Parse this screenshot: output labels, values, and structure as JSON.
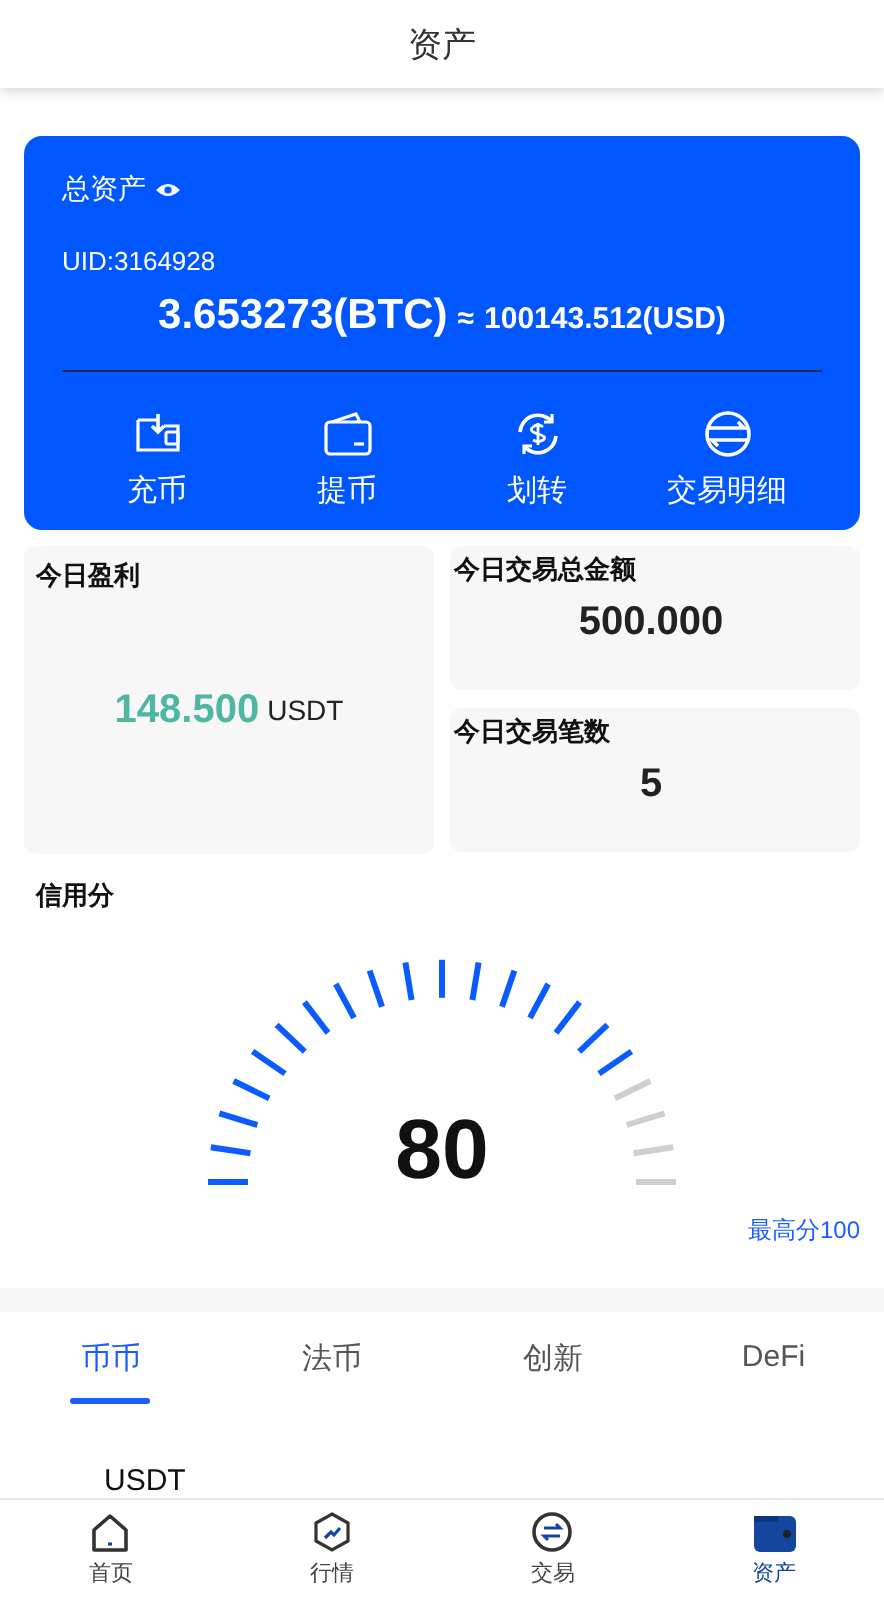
{
  "header": {
    "title": "资产"
  },
  "asset_card": {
    "label": "总资产",
    "uid": "UID:3164928",
    "btc": "3.653273(BTC)",
    "approx": "≈",
    "usd": "100143.512(USD)",
    "actions": [
      {
        "kind": "deposit",
        "label": "充币"
      },
      {
        "kind": "withdraw",
        "label": "提币"
      },
      {
        "kind": "transfer",
        "label": "划转"
      },
      {
        "kind": "history",
        "label": "交易明细"
      }
    ]
  },
  "stats": {
    "profit": {
      "label": "今日盈利",
      "value": "148.500",
      "unit": "USDT"
    },
    "volume": {
      "label": "今日交易总金额",
      "value": "500.000"
    },
    "count": {
      "label": "今日交易笔数",
      "value": "5"
    }
  },
  "credit": {
    "label": "信用分",
    "score": "80",
    "level": 0.8,
    "max_label": "最高分100"
  },
  "tabs": [
    {
      "label": "币币",
      "selected": true
    },
    {
      "label": "法币",
      "selected": false
    },
    {
      "label": "创新",
      "selected": false
    },
    {
      "label": "DeFi",
      "selected": false
    }
  ],
  "list": [
    {
      "coin": "USDT"
    }
  ],
  "bottom_nav": [
    {
      "kind": "home",
      "label": "首页",
      "selected": false
    },
    {
      "kind": "market",
      "label": "行情",
      "selected": false
    },
    {
      "kind": "trade",
      "label": "交易",
      "selected": false
    },
    {
      "kind": "assets",
      "label": "资产",
      "selected": true
    }
  ]
}
